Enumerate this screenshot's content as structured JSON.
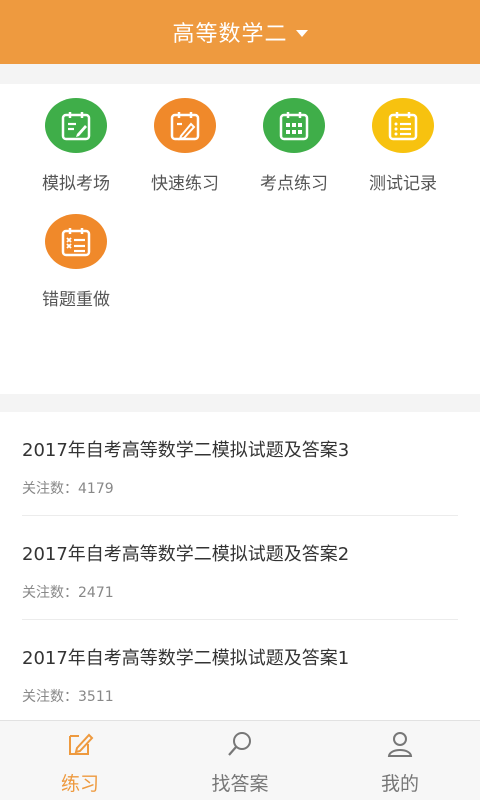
{
  "header": {
    "title": "高等数学二",
    "dropdown_icon": "caret-down-icon",
    "color": "#ee9a3f"
  },
  "functions": [
    {
      "label": "模拟考场",
      "icon": "calendar-edit-icon",
      "color": "#3fae49"
    },
    {
      "label": "快速练习",
      "icon": "calendar-pencil-icon",
      "color": "#f0892a"
    },
    {
      "label": "考点练习",
      "icon": "calendar-grid-icon",
      "color": "#3fae49"
    },
    {
      "label": "测试记录",
      "icon": "calendar-list-icon",
      "color": "#f7c20f"
    },
    {
      "label": "错题重做",
      "icon": "calendar-wrong-list-icon",
      "color": "#f0892a"
    }
  ],
  "list": [
    {
      "title": "2017年自考高等数学二模拟试题及答案3",
      "count": "关注数：4179"
    },
    {
      "title": "2017年自考高等数学二模拟试题及答案2",
      "count": "关注数：2471"
    },
    {
      "title": "2017年自考高等数学二模拟试题及答案1",
      "count": "关注数：3511"
    }
  ],
  "tabs": [
    {
      "label": "练习",
      "icon": "edit-icon",
      "active": true
    },
    {
      "label": "找答案",
      "icon": "search-icon",
      "active": false
    },
    {
      "label": "我的",
      "icon": "user-icon",
      "active": false
    }
  ],
  "colors": {
    "accent": "#ee9a3f",
    "inactive": "#777777"
  }
}
